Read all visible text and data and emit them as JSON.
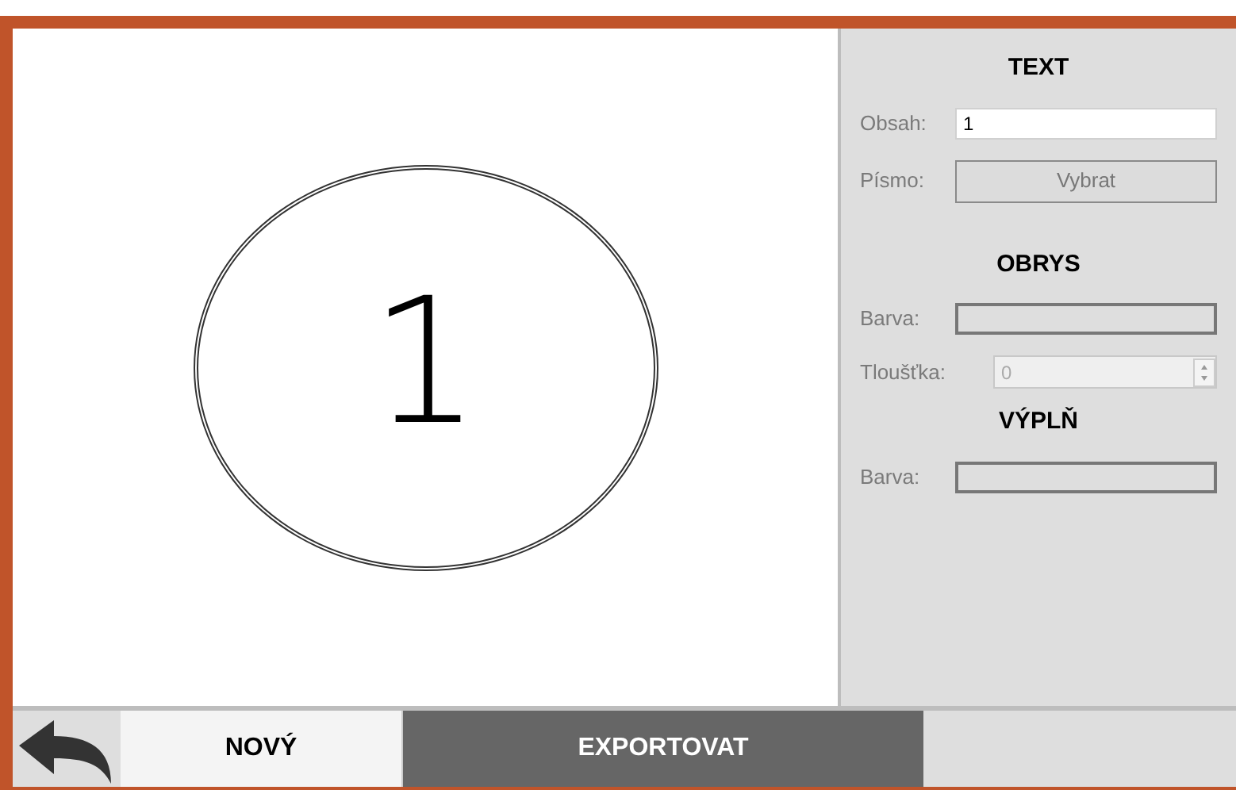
{
  "canvas": {
    "shape_text": "1"
  },
  "panel": {
    "sections": [
      {
        "title": "TEXT",
        "rows": [
          {
            "kind": "text",
            "label": "Obsah:",
            "value": "1"
          },
          {
            "kind": "button",
            "label": "Písmo:",
            "button": "Vybrat"
          }
        ]
      },
      {
        "title": "OBRYS",
        "rows": [
          {
            "kind": "color",
            "label": "Barva:"
          },
          {
            "kind": "spin",
            "label": "Tloušťka:",
            "value": "0",
            "disabled": true
          }
        ]
      },
      {
        "title": "VÝPLŇ",
        "rows": [
          {
            "kind": "color",
            "label": "Barva:"
          }
        ]
      }
    ]
  },
  "bottom": {
    "buttons": [
      {
        "label": "NOVÝ",
        "kind": "light"
      },
      {
        "label": "EXPORTOVAT",
        "kind": "dark"
      }
    ]
  }
}
